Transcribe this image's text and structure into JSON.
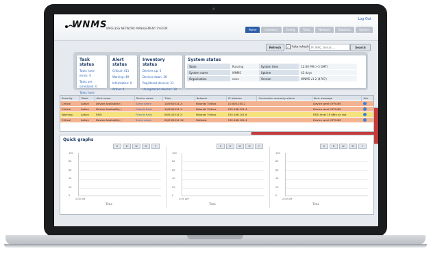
{
  "app": {
    "logo": "WNMS",
    "subtitle": "WIRELESS NETWORK MANAGEMENT SYSTEM",
    "logout": "Log Out",
    "tabs": [
      "Home",
      "Alerts",
      "Inventory",
      "Config",
      "Tasks",
      "Network",
      "Statistics",
      "System"
    ]
  },
  "toolbar": {
    "refresh": "Refresh",
    "auto_refresh": "Auto refresh",
    "search_placeholder": "IP, MAC, Serial, ...",
    "search": "Search"
  },
  "task_status": {
    "title": "Task status",
    "lines": [
      "Tasks have errors: 0",
      "Tasks are scheduled: 0",
      "Tasks have finished: 5"
    ]
  },
  "alert_status": {
    "title": "Alert status",
    "lines": [
      "Critical: 411",
      "Warning: 49",
      "Information: 0",
      "Active: 4"
    ]
  },
  "inventory_status": {
    "title": "Inventory status",
    "lines": [
      "Devices up: 5",
      "Devices down: 38",
      "Registered devices: 23",
      "Unregistered devices: 18"
    ]
  },
  "system_status": {
    "title": "System status",
    "rows": [
      {
        "k1": "State",
        "v1": "Running",
        "k2": "System time",
        "v2": "12:00 PM (+3 GMT)"
      },
      {
        "k1": "System name",
        "v1": "WNMS",
        "k2": "Uptime",
        "v2": "42 days"
      },
      {
        "k1": "Organization",
        "v1": "none",
        "k2": "Version",
        "v2": "WNMS v1.2 (4787)"
      }
    ]
  },
  "alerts_table": {
    "headers": [
      "Severity",
      "State",
      "Alert name",
      "Device name",
      "Time",
      "Network",
      "IP address",
      "Connection warranty status",
      "Alert message",
      "Ack"
    ],
    "rows": [
      {
        "sev": "Critical",
        "state": "Active",
        "name": "Device Availability (",
        "device": "Some name",
        "time": "10/09/2014 2:",
        "network": "Rolands Tinklas",
        "ip": "10.000.100.2",
        "warranty": "",
        "msg": "Device went OFFLINE",
        "level": "crit"
      },
      {
        "sev": "Critical",
        "state": "Active",
        "name": "Device Availability (",
        "device": "Friends Rails",
        "time": "10/09/2014 1:",
        "network": "Rolands Tinklas",
        "ip": "192.168.101.4",
        "warranty": "",
        "msg": "Device went OFFLINE",
        "level": "crit"
      },
      {
        "sev": "Warning",
        "state": "Active",
        "name": "RSSI",
        "device": "Friends Rails",
        "time": "09/02/2014 2:",
        "network": "Rolands Tinklas",
        "ip": "192.168.101.6",
        "warranty": "",
        "msg": "RSSI level 19 dBm on rad",
        "level": "warn"
      },
      {
        "sev": "Critical",
        "state": "Active",
        "name": "Device Availability (",
        "device": "Some name",
        "time": "09/23/2014 12:",
        "network": "Hellbest",
        "ip": "192.168.101.4",
        "warranty": "",
        "msg": "Device went OFFLINE",
        "level": "crit"
      }
    ]
  },
  "quick_graphs": {
    "title": "Quick graphs",
    "range_buttons": [
      "H",
      "D",
      "W",
      "M",
      "Y"
    ],
    "y_ticks": [
      "100",
      "80",
      "60",
      "40",
      "20",
      "0"
    ],
    "x_tick": "2:00 AM",
    "x_label": "Time"
  }
}
